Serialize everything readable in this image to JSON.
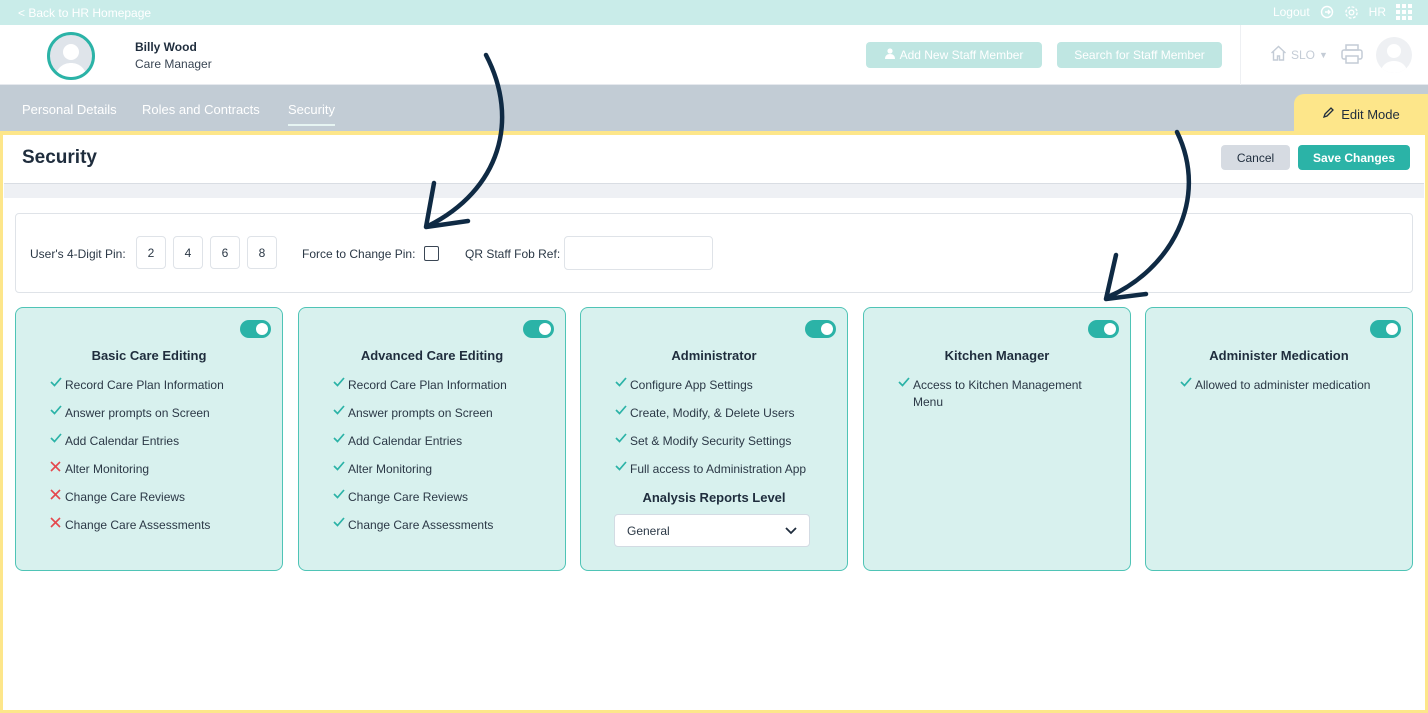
{
  "topbar": {
    "back_link": "< Back to HR Homepage",
    "logout": "Logout",
    "user_initials": "HR"
  },
  "header": {
    "user_name": "Billy Wood",
    "user_role": "Care Manager",
    "add_staff_label": "Add New Staff Member",
    "search_staff_label": "Search for Staff Member",
    "location": "SLO"
  },
  "tabs": [
    {
      "label": "Personal Details",
      "active": false
    },
    {
      "label": "Roles and Contracts",
      "active": false
    },
    {
      "label": "Security",
      "active": true
    }
  ],
  "edit_mode_label": "Edit Mode",
  "section": {
    "title": "Security",
    "cancel_label": "Cancel",
    "save_label": "Save Changes"
  },
  "pin": {
    "label": "User's 4-Digit Pin:",
    "digits": [
      "2",
      "4",
      "6",
      "8"
    ],
    "force_change_label": "Force to Change Pin:",
    "force_change_checked": false,
    "qr_label": "QR Staff Fob Ref:",
    "qr_value": ""
  },
  "colors": {
    "accent": "#2bb3a7",
    "card_bg": "#d8f1ee",
    "edit_mode": "#fde68a",
    "deny": "#e5484d"
  },
  "cards": [
    {
      "title": "Basic Care Editing",
      "enabled": true,
      "permissions": [
        {
          "label": "Record Care Plan Information",
          "allowed": true
        },
        {
          "label": "Answer prompts on Screen",
          "allowed": true
        },
        {
          "label": "Add Calendar Entries",
          "allowed": true
        },
        {
          "label": "Alter Monitoring",
          "allowed": false
        },
        {
          "label": "Change Care Reviews",
          "allowed": false
        },
        {
          "label": "Change Care Assessments",
          "allowed": false
        }
      ]
    },
    {
      "title": "Advanced Care Editing",
      "enabled": true,
      "permissions": [
        {
          "label": "Record Care Plan Information",
          "allowed": true
        },
        {
          "label": "Answer prompts on Screen",
          "allowed": true
        },
        {
          "label": "Add Calendar Entries",
          "allowed": true
        },
        {
          "label": "Alter Monitoring",
          "allowed": true
        },
        {
          "label": "Change Care Reviews",
          "allowed": true
        },
        {
          "label": "Change Care Assessments",
          "allowed": true
        }
      ]
    },
    {
      "title": "Administrator",
      "enabled": true,
      "permissions": [
        {
          "label": "Configure App Settings",
          "allowed": true
        },
        {
          "label": "Create, Modify, & Delete Users",
          "allowed": true
        },
        {
          "label": "Set & Modify Security Settings",
          "allowed": true
        },
        {
          "label": "Full access to Administration App",
          "allowed": true
        }
      ],
      "reports_level_label": "Analysis Reports Level",
      "reports_level_value": "General"
    },
    {
      "title": "Kitchen Manager",
      "enabled": true,
      "permissions": [
        {
          "label": "Access to Kitchen Management Menu",
          "allowed": true
        }
      ]
    },
    {
      "title": "Administer Medication",
      "enabled": true,
      "permissions": [
        {
          "label": "Allowed to administer medication",
          "allowed": true
        }
      ]
    }
  ]
}
